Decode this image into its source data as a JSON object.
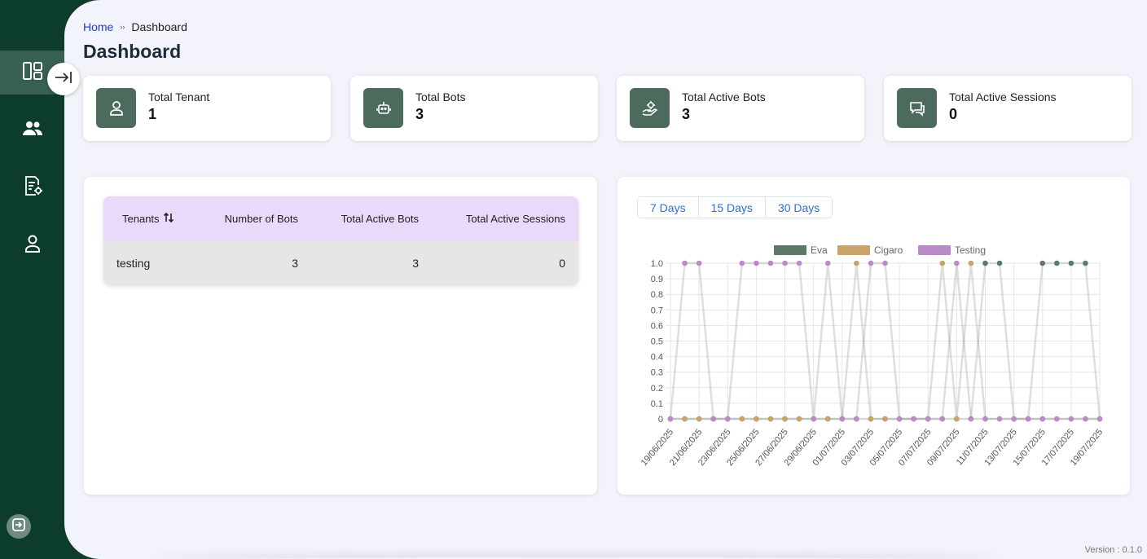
{
  "breadcrumb": {
    "home": "Home",
    "separator": "››",
    "current": "Dashboard"
  },
  "page_title": "Dashboard",
  "sidebar": {
    "items": [
      {
        "icon": "dashboard-icon",
        "active": true
      },
      {
        "icon": "users-icon",
        "active": false
      },
      {
        "icon": "document-settings-icon",
        "active": false
      },
      {
        "icon": "user-icon",
        "active": false
      }
    ],
    "logout_icon": "logout-icon",
    "toggle_icon": "collapse-arrow-icon"
  },
  "stats": [
    {
      "label": "Total Tenant",
      "value": "1",
      "icon": "user-icon"
    },
    {
      "label": "Total Bots",
      "value": "3",
      "icon": "robot-icon"
    },
    {
      "label": "Total Active Bots",
      "value": "3",
      "icon": "hand-gear-icon"
    },
    {
      "label": "Total Active Sessions",
      "value": "0",
      "icon": "chat-bubbles-icon"
    }
  ],
  "table": {
    "headers": [
      "Tenants",
      "Number of Bots",
      "Total Active Bots",
      "Total Active Sessions"
    ],
    "sort_icon": "sort-arrows-icon",
    "rows": [
      [
        "testing",
        "3",
        "3",
        "0"
      ]
    ]
  },
  "ranges": [
    "7 Days",
    "15 Days",
    "30 Days"
  ],
  "colors": {
    "sidebar": "#0b3d2a",
    "icon_tile": "#4d6b5c",
    "header_row": "#e9d9fb",
    "link": "#1a3fd6"
  },
  "chart_data": {
    "type": "line",
    "x": [
      "19/06/2025",
      "20/06/2025",
      "21/06/2025",
      "22/06/2025",
      "23/06/2025",
      "24/06/2025",
      "25/06/2025",
      "26/06/2025",
      "27/06/2025",
      "28/06/2025",
      "29/06/2025",
      "30/06/2025",
      "01/07/2025",
      "02/07/2025",
      "03/07/2025",
      "04/07/2025",
      "05/07/2025",
      "06/07/2025",
      "07/07/2025",
      "08/07/2025",
      "09/07/2025",
      "10/07/2025",
      "11/07/2025",
      "12/07/2025",
      "13/07/2025",
      "14/07/2025",
      "15/07/2025",
      "16/07/2025",
      "17/07/2025",
      "18/07/2025",
      "19/07/2025"
    ],
    "x_tick_labels": [
      "19/06/2025",
      "21/06/2025",
      "23/06/2025",
      "25/06/2025",
      "27/06/2025",
      "29/06/2025",
      "01/07/2025",
      "03/07/2025",
      "05/07/2025",
      "07/07/2025",
      "09/07/2025",
      "11/07/2025",
      "13/07/2025",
      "15/07/2025",
      "17/07/2025",
      "19/07/2025"
    ],
    "y_ticks": [
      "0",
      "0.1",
      "0.2",
      "0.3",
      "0.4",
      "0.5",
      "0.6",
      "0.7",
      "0.8",
      "0.9",
      "1.0"
    ],
    "ylim": [
      0,
      1
    ],
    "grid": true,
    "legend_position": "top",
    "series": [
      {
        "name": "Eva",
        "color": "#5b7a68",
        "values": [
          0,
          0,
          0,
          0,
          0,
          0,
          0,
          0,
          0,
          0,
          0,
          0,
          0,
          0,
          0,
          0,
          0,
          0,
          0,
          0,
          0,
          0,
          1,
          1,
          0,
          0,
          1,
          1,
          1,
          1,
          0
        ]
      },
      {
        "name": "Cigaro",
        "color": "#c9a36a",
        "values": [
          0,
          0,
          0,
          0,
          0,
          0,
          0,
          0,
          0,
          0,
          0,
          0,
          0,
          1,
          0,
          0,
          0,
          0,
          0,
          1,
          0,
          1,
          0,
          0,
          0,
          0,
          0,
          0,
          0,
          0,
          0
        ]
      },
      {
        "name": "Testing",
        "color": "#b98cc8",
        "values": [
          0,
          1,
          1,
          0,
          0,
          1,
          1,
          1,
          1,
          1,
          0,
          1,
          0,
          0,
          1,
          1,
          0,
          0,
          0,
          0,
          1,
          0,
          0,
          0,
          0,
          0,
          0,
          0,
          0,
          0,
          0
        ]
      }
    ]
  },
  "version": "Version : 0.1.0"
}
